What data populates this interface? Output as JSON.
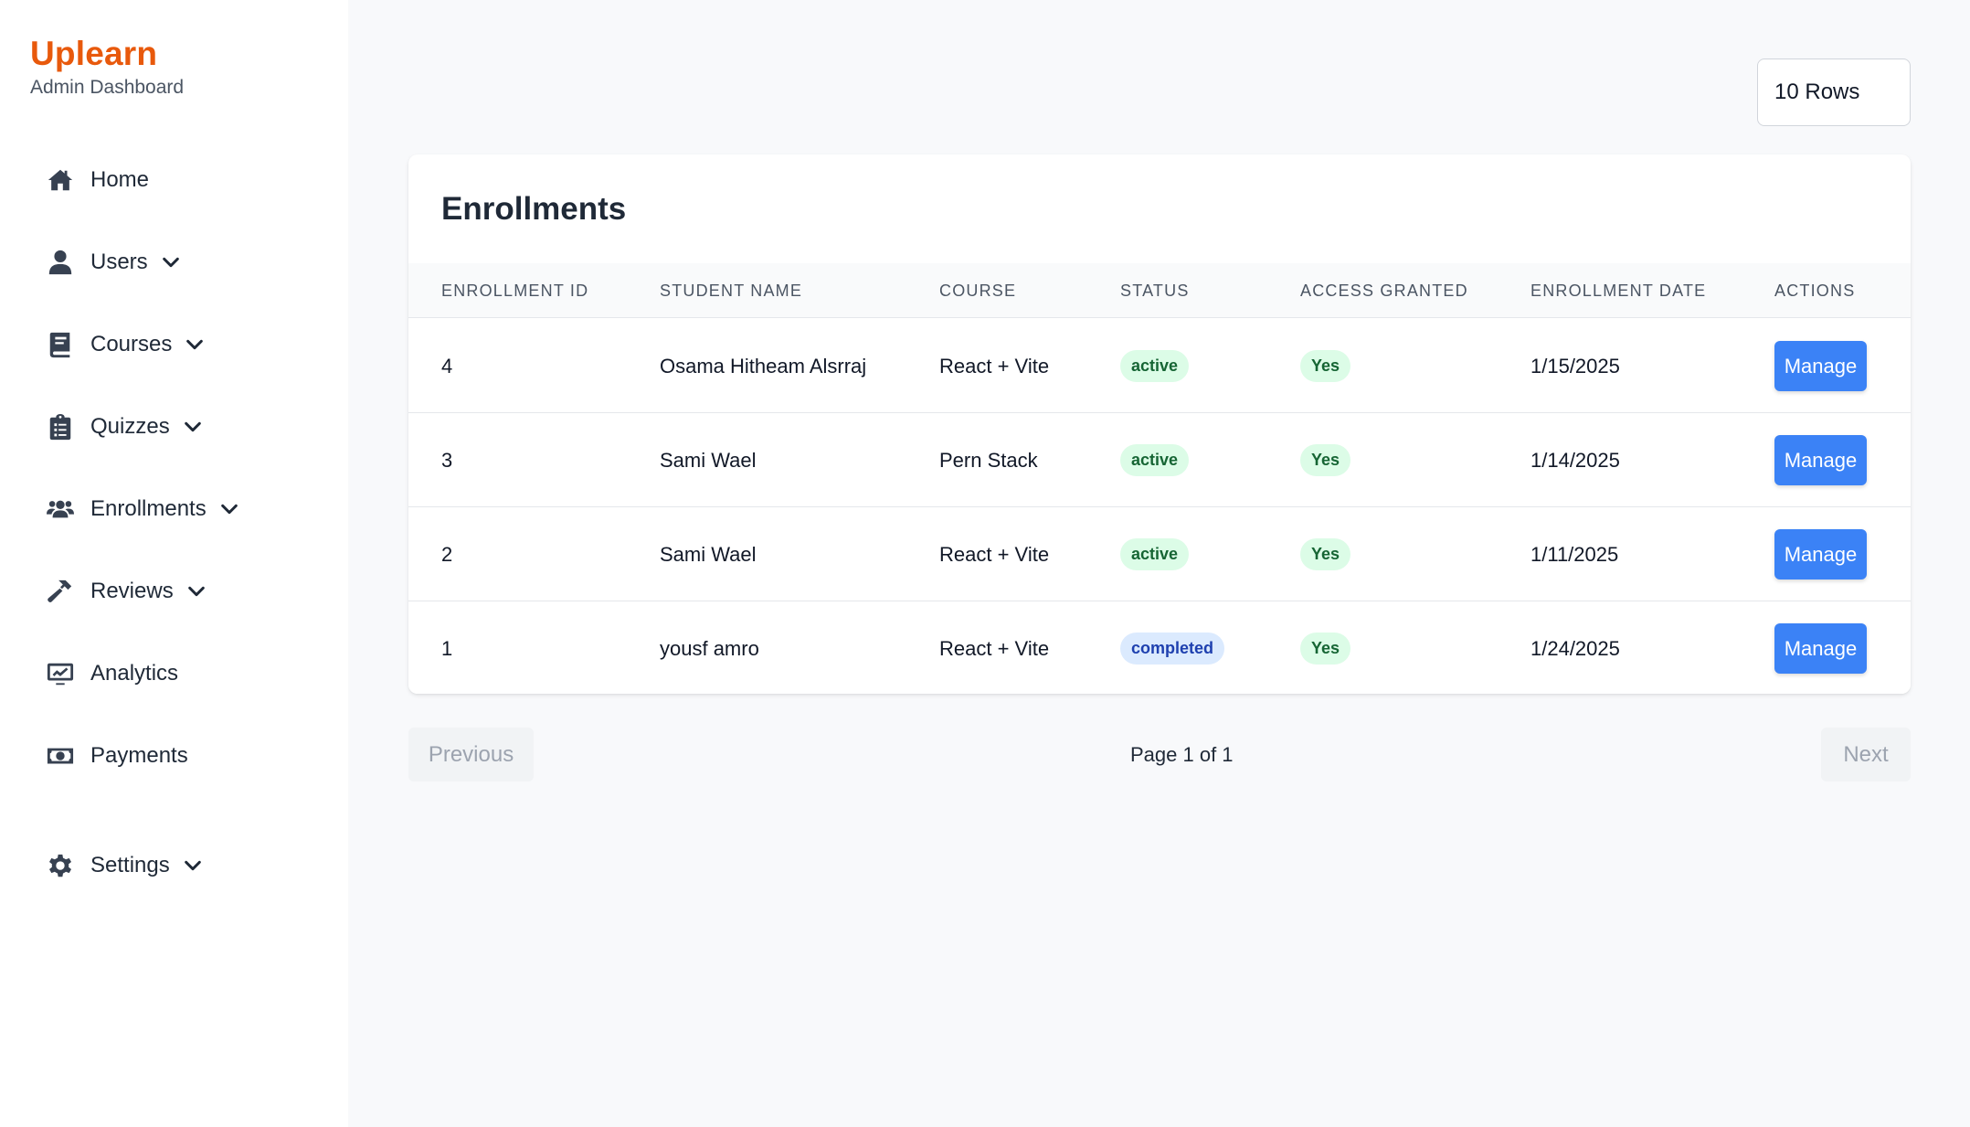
{
  "brand": {
    "title": "Uplearn",
    "subtitle": "Admin Dashboard",
    "color": "#e8590c"
  },
  "sidebar": {
    "items": [
      {
        "label": "Home",
        "icon": "home-icon",
        "has_submenu": false
      },
      {
        "label": "Users",
        "icon": "user-icon",
        "has_submenu": true
      },
      {
        "label": "Courses",
        "icon": "book-icon",
        "has_submenu": true
      },
      {
        "label": "Quizzes",
        "icon": "clipboard-icon",
        "has_submenu": true
      },
      {
        "label": "Enrollments",
        "icon": "users-group-icon",
        "has_submenu": true
      },
      {
        "label": "Reviews",
        "icon": "hammer-icon",
        "has_submenu": true
      },
      {
        "label": "Analytics",
        "icon": "chart-monitor-icon",
        "has_submenu": false
      },
      {
        "label": "Payments",
        "icon": "money-bill-icon",
        "has_submenu": false
      },
      {
        "label": "Settings",
        "icon": "gear-icon",
        "has_submenu": true
      }
    ]
  },
  "rows_select": {
    "value": "10 Rows"
  },
  "table": {
    "title": "Enrollments",
    "columns": [
      "Enrollment ID",
      "Student Name",
      "Course",
      "Status",
      "Access Granted",
      "Enrollment Date",
      "Actions"
    ],
    "rows": [
      {
        "id": "4",
        "student": "Osama Hitheam Alsrraj",
        "course": "React + Vite",
        "status": "active",
        "access": "Yes",
        "date": "1/15/2025",
        "action": "Manage"
      },
      {
        "id": "3",
        "student": "Sami Wael",
        "course": "Pern Stack",
        "status": "active",
        "access": "Yes",
        "date": "1/14/2025",
        "action": "Manage"
      },
      {
        "id": "2",
        "student": "Sami Wael",
        "course": "React + Vite",
        "status": "active",
        "access": "Yes",
        "date": "1/11/2025",
        "action": "Manage"
      },
      {
        "id": "1",
        "student": "yousf amro",
        "course": "React + Vite",
        "status": "completed",
        "access": "Yes",
        "date": "1/24/2025",
        "action": "Manage"
      }
    ]
  },
  "pagination": {
    "previous": "Previous",
    "next": "Next",
    "info": "Page 1 of 1"
  },
  "colors": {
    "primary": "#3b82f6",
    "active_badge_bg": "#dcfce7",
    "completed_badge_bg": "#dbeafe"
  }
}
